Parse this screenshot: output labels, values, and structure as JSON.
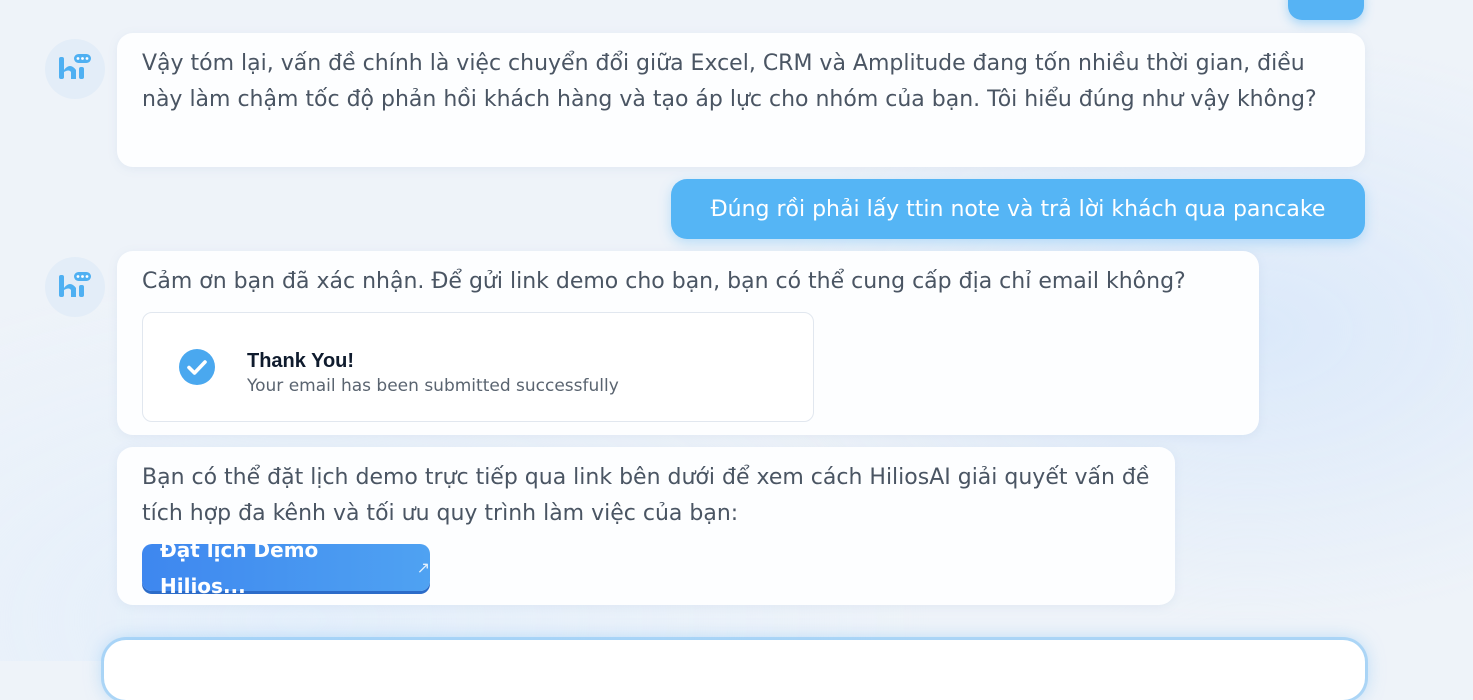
{
  "messages": [
    {
      "role": "assistant",
      "text": "Vậy tóm lại, vấn đề chính là việc chuyển đổi giữa Excel, CRM và Amplitude đang tốn nhiều thời gian, điều này làm chậm tốc độ phản hồi khách hàng và tạo áp lực cho nhóm của bạn. Tôi hiểu đúng như vậy không?"
    },
    {
      "role": "user",
      "text": "Đúng rồi phải lấy ttin note và trả lời khách qua pancake"
    },
    {
      "role": "assistant",
      "text": "Cảm ơn bạn đã xác nhận. Để gửi link demo cho bạn, bạn có thể cung cấp địa chỉ email không?",
      "card": {
        "title": "Thank You!",
        "subtitle": "Your email has been submitted successfully"
      }
    },
    {
      "role": "assistant",
      "text": "Bạn có thể đặt lịch demo trực tiếp qua link bên dưới để xem cách HiliosAI giải quyết vấn đề tích hợp đa kênh và tối ưu quy trình làm việc của bạn:",
      "button_label": "Đặt lịch Demo Hilios...",
      "button_icon": "↗"
    }
  ],
  "colors": {
    "accent": "#55b5f5",
    "button": "#3e87ef",
    "bubble": "#fdfeff",
    "text": "#4a5563"
  }
}
